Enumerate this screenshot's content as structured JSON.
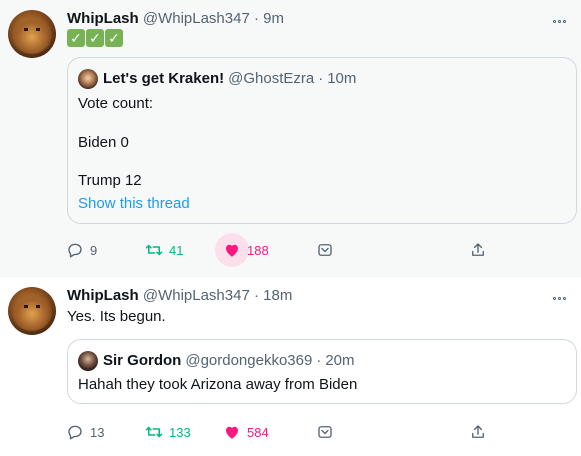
{
  "tweets": [
    {
      "author_name": "WhipLash",
      "author_handle": "@WhipLash347",
      "separator": "·",
      "time": "9m",
      "checkmarks": [
        "✓",
        "✓",
        "✓"
      ],
      "quote": {
        "author_name": "Let's get Kraken!",
        "author_handle": "@GhostEzra",
        "separator": "·",
        "time": "10m",
        "lines": [
          "Vote count:",
          "Biden 0",
          "Trump 12"
        ],
        "link": "Show this thread"
      },
      "replies": "9",
      "retweets": "41",
      "likes": "188",
      "liked": true,
      "colors": {
        "retweet": "#00ba7c",
        "like": "#f91880",
        "link": "#1d9bf0"
      }
    },
    {
      "author_name": "WhipLash",
      "author_handle": "@WhipLash347",
      "separator": "·",
      "time": "18m",
      "text": "Yes. Its begun.",
      "quote": {
        "author_name": "Sir Gordon",
        "author_handle": "@gordongekko369",
        "separator": "·",
        "time": "20m",
        "text": "Hahah they took Arizona away from Biden"
      },
      "replies": "13",
      "retweets": "133",
      "likes": "584",
      "liked": true
    }
  ],
  "icons": {
    "reply": "reply-icon",
    "retweet": "retweet-icon",
    "like": "heart-icon",
    "save": "save-icon",
    "share": "share-icon",
    "more": "more-icon"
  }
}
